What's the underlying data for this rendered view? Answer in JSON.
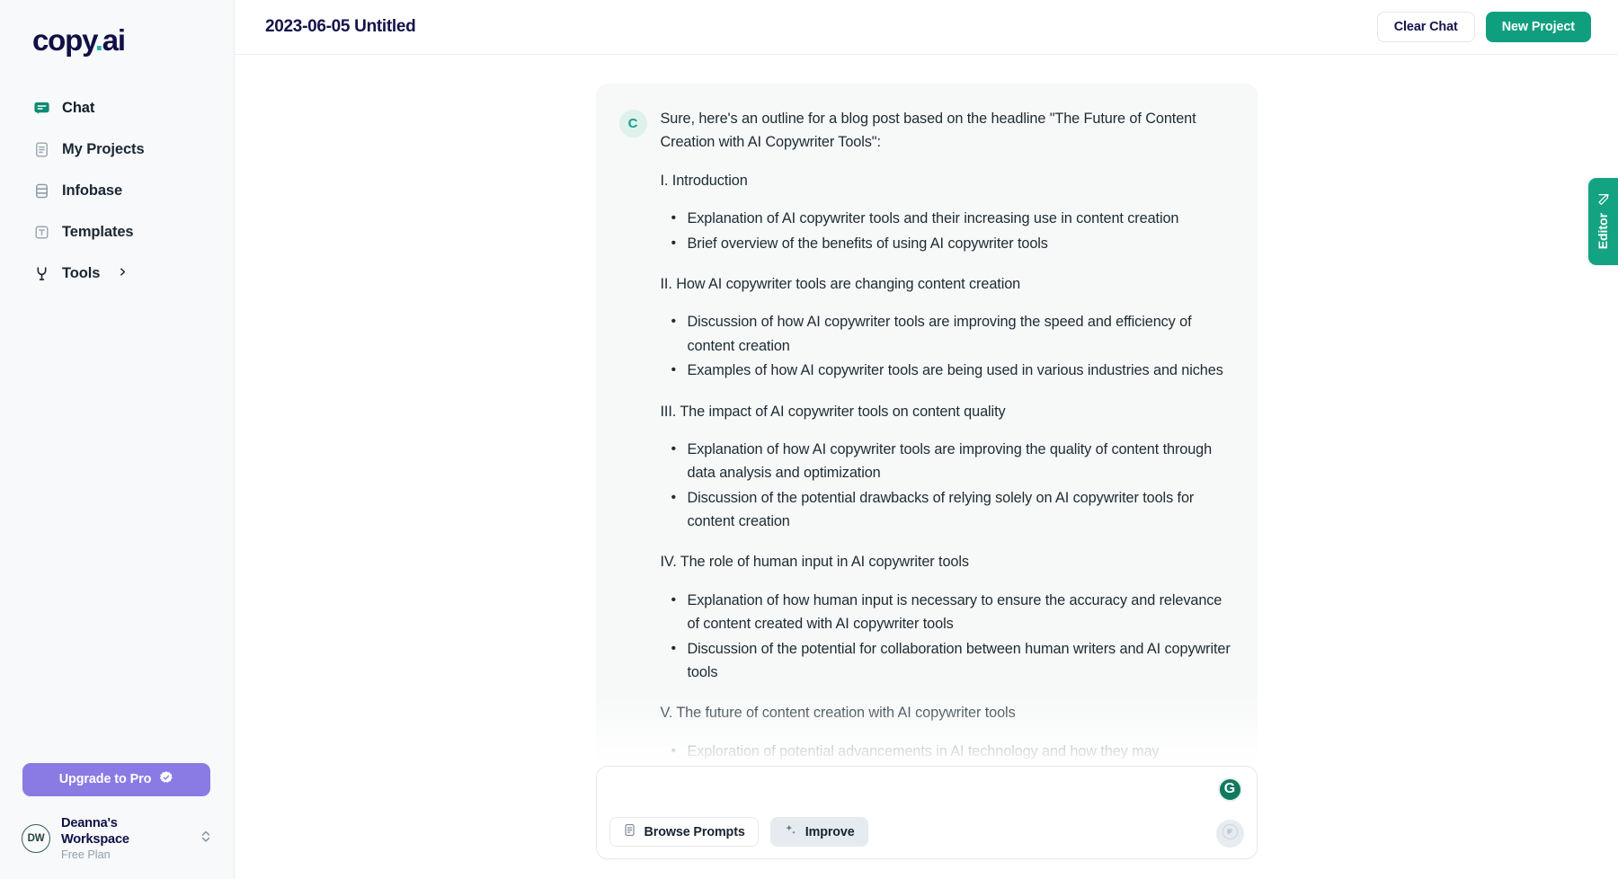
{
  "sidebar": {
    "logo": {
      "main": "copy",
      "dot": ".",
      "suffix": "ai"
    },
    "items": [
      {
        "label": "Chat",
        "icon": "chat-bubble-icon",
        "active": true
      },
      {
        "label": "My Projects",
        "icon": "document-icon",
        "active": false
      },
      {
        "label": "Infobase",
        "icon": "database-icon",
        "active": false
      },
      {
        "label": "Templates",
        "icon": "template-icon",
        "active": false
      },
      {
        "label": "Tools",
        "icon": "tools-icon",
        "active": false,
        "chevron": "chevron-right-icon"
      }
    ],
    "upgrade": {
      "label": "Upgrade to Pro",
      "icon": "verified-badge-icon",
      "color": "#8a7ae4"
    },
    "workspace": {
      "initials": "DW",
      "name": "Deanna's Workspace",
      "plan": "Free Plan",
      "caret": "chevron-up-down-icon"
    }
  },
  "topbar": {
    "title": "2023-06-05 Untitled",
    "clear_chat_label": "Clear Chat",
    "new_project_label": "New Project",
    "primary_color": "#0f9f7e"
  },
  "editor_tab": {
    "label": "Editor",
    "icon": "pencil-icon",
    "color": "#13a383"
  },
  "message": {
    "avatar_initial": "C",
    "intro": "Sure, here's an outline for a blog post based on the headline \"The Future of Content Creation with AI Copywriter Tools\":",
    "sections": [
      {
        "heading": "I. Introduction",
        "bullets": [
          "Explanation of AI copywriter tools and their increasing use in content creation",
          "Brief overview of the benefits of using AI copywriter tools"
        ]
      },
      {
        "heading": "II. How AI copywriter tools are changing content creation",
        "bullets": [
          "Discussion of how AI copywriter tools are improving the speed and efficiency of content creation",
          "Examples of how AI copywriter tools are being used in various industries and niches"
        ]
      },
      {
        "heading": "III. The impact of AI copywriter tools on content quality",
        "bullets": [
          "Explanation of how AI copywriter tools are improving the quality of content through data analysis and optimization",
          "Discussion of the potential drawbacks of relying solely on AI copywriter tools for content creation"
        ]
      },
      {
        "heading": "IV. The role of human input in AI copywriter tools",
        "bullets": [
          "Explanation of how human input is necessary to ensure the accuracy and relevance of content created with AI copywriter tools",
          "Discussion of the potential for collaboration between human writers and AI copywriter tools"
        ]
      },
      {
        "heading": "V. The future of content creation with AI copywriter tools",
        "bullets": [
          "Exploration of potential advancements in AI technology and how they may"
        ]
      }
    ]
  },
  "composer": {
    "input_value": "",
    "input_placeholder": "",
    "browse_prompts_label": "Browse Prompts",
    "improve_label": "Improve",
    "grammarly_icon": "grammarly-icon",
    "send_icon": "send-arrow-icon"
  }
}
